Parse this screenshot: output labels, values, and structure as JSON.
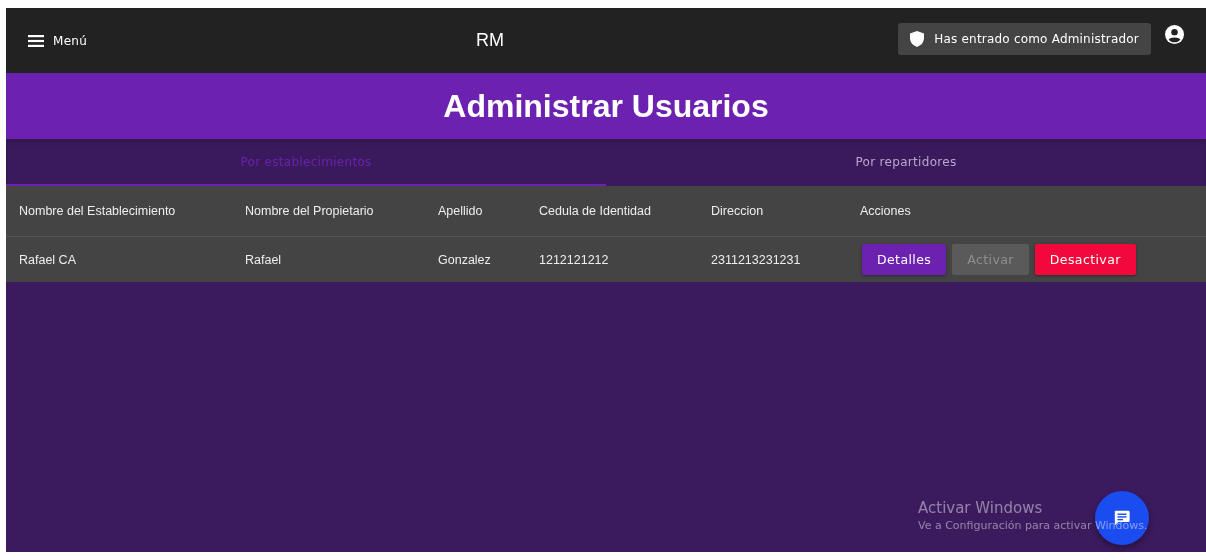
{
  "top_bar": {
    "menu_label": "Menú",
    "brand": "RM",
    "role_badge": "Has entrado como Administrador"
  },
  "page_title": "Administrar Usuarios",
  "tabs": [
    {
      "label": "Por establecimientos",
      "selected": true
    },
    {
      "label": "Por repartidores",
      "selected": false
    }
  ],
  "table": {
    "columns": [
      "Nombre del Establecimiento",
      "Nombre del Propietario",
      "Apellido",
      "Cedula de Identidad",
      "Direccion",
      "Acciones"
    ],
    "rows": [
      {
        "cells": [
          "Rafael CA",
          "Rafael",
          "Gonzalez",
          "1212121212",
          "2311213231231"
        ],
        "actions": [
          {
            "label": "Detalles",
            "kind": "primary",
            "disabled": false
          },
          {
            "label": "Activar",
            "kind": "primary",
            "disabled": true
          },
          {
            "label": "Desactivar",
            "kind": "danger",
            "disabled": false
          }
        ]
      }
    ]
  },
  "os_notice": {
    "title": "Activar Windows",
    "message": "Ve a Configuración para activar Windows."
  }
}
